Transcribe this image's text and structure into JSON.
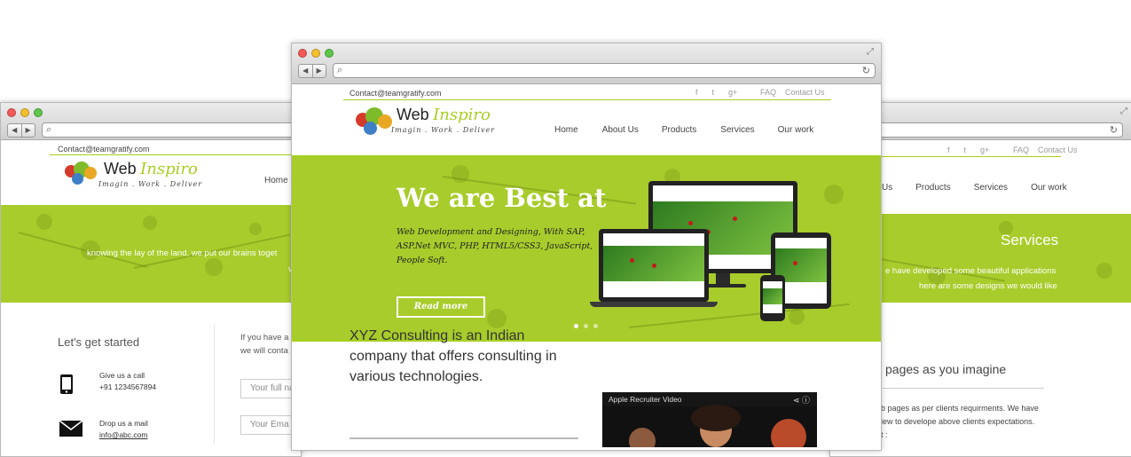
{
  "left_window": {
    "contact": "Contact@teamgratify.com",
    "logo": {
      "word1": "Web",
      "word2": "Inspiro",
      "tagline": "Imagin . Work . Deliver"
    },
    "menu": [
      "Home"
    ],
    "hero_text": "knowing the lay of the land, we put our brains toget",
    "hero_text2": "v",
    "lets_started": "Let's get started",
    "hint1": "If you have a",
    "hint2": "we will conta",
    "name_placeholder": "Your full na",
    "email_placeholder": "Your Ema",
    "contacts": [
      {
        "icon": "phone-icon",
        "title": "Give us a call",
        "value": "+91 1234567894"
      },
      {
        "icon": "mail-icon",
        "title": "Drop us a mail",
        "value": "info@abc.com"
      }
    ]
  },
  "right_window": {
    "social": [
      "f",
      "t",
      "g+"
    ],
    "links": [
      "FAQ",
      "Contact Us"
    ],
    "menu": [
      "Us",
      "Products",
      "Services",
      "Our work"
    ],
    "hero_title": "Services",
    "hero_line1": "e have developed some beautiful applications",
    "hero_line2": "here are some designs we would like",
    "section_title": "pages as you imagine",
    "text1": "b pages as per clients requirments. We have",
    "text2": "iew to develope above clients expectations.",
    "text3": "t :"
  },
  "center_window": {
    "contact": "Contact@teamgratify.com",
    "social": [
      "f",
      "t",
      "g+"
    ],
    "links": [
      "FAQ",
      "Contact Us"
    ],
    "logo": {
      "word1": "Web",
      "word2": "Inspiro",
      "tagline": "Imagin . Work . Deliver"
    },
    "menu": [
      "Home",
      "About Us",
      "Products",
      "Services",
      "Our work"
    ],
    "hero": {
      "title": "We are Best at",
      "desc": "Web Development and Designing, With SAP, ASP.Net MVC, PHP, HTML5/CSS3, JavaScript, People Soft.",
      "button": "Read more"
    },
    "intro": "XYZ Consulting is an Indian company that offers consulting in various technologies.",
    "video_title": "Apple Recruiter Video"
  },
  "colors": {
    "accent": "#a6cf23",
    "hero_bg": "#a8cc2b"
  }
}
